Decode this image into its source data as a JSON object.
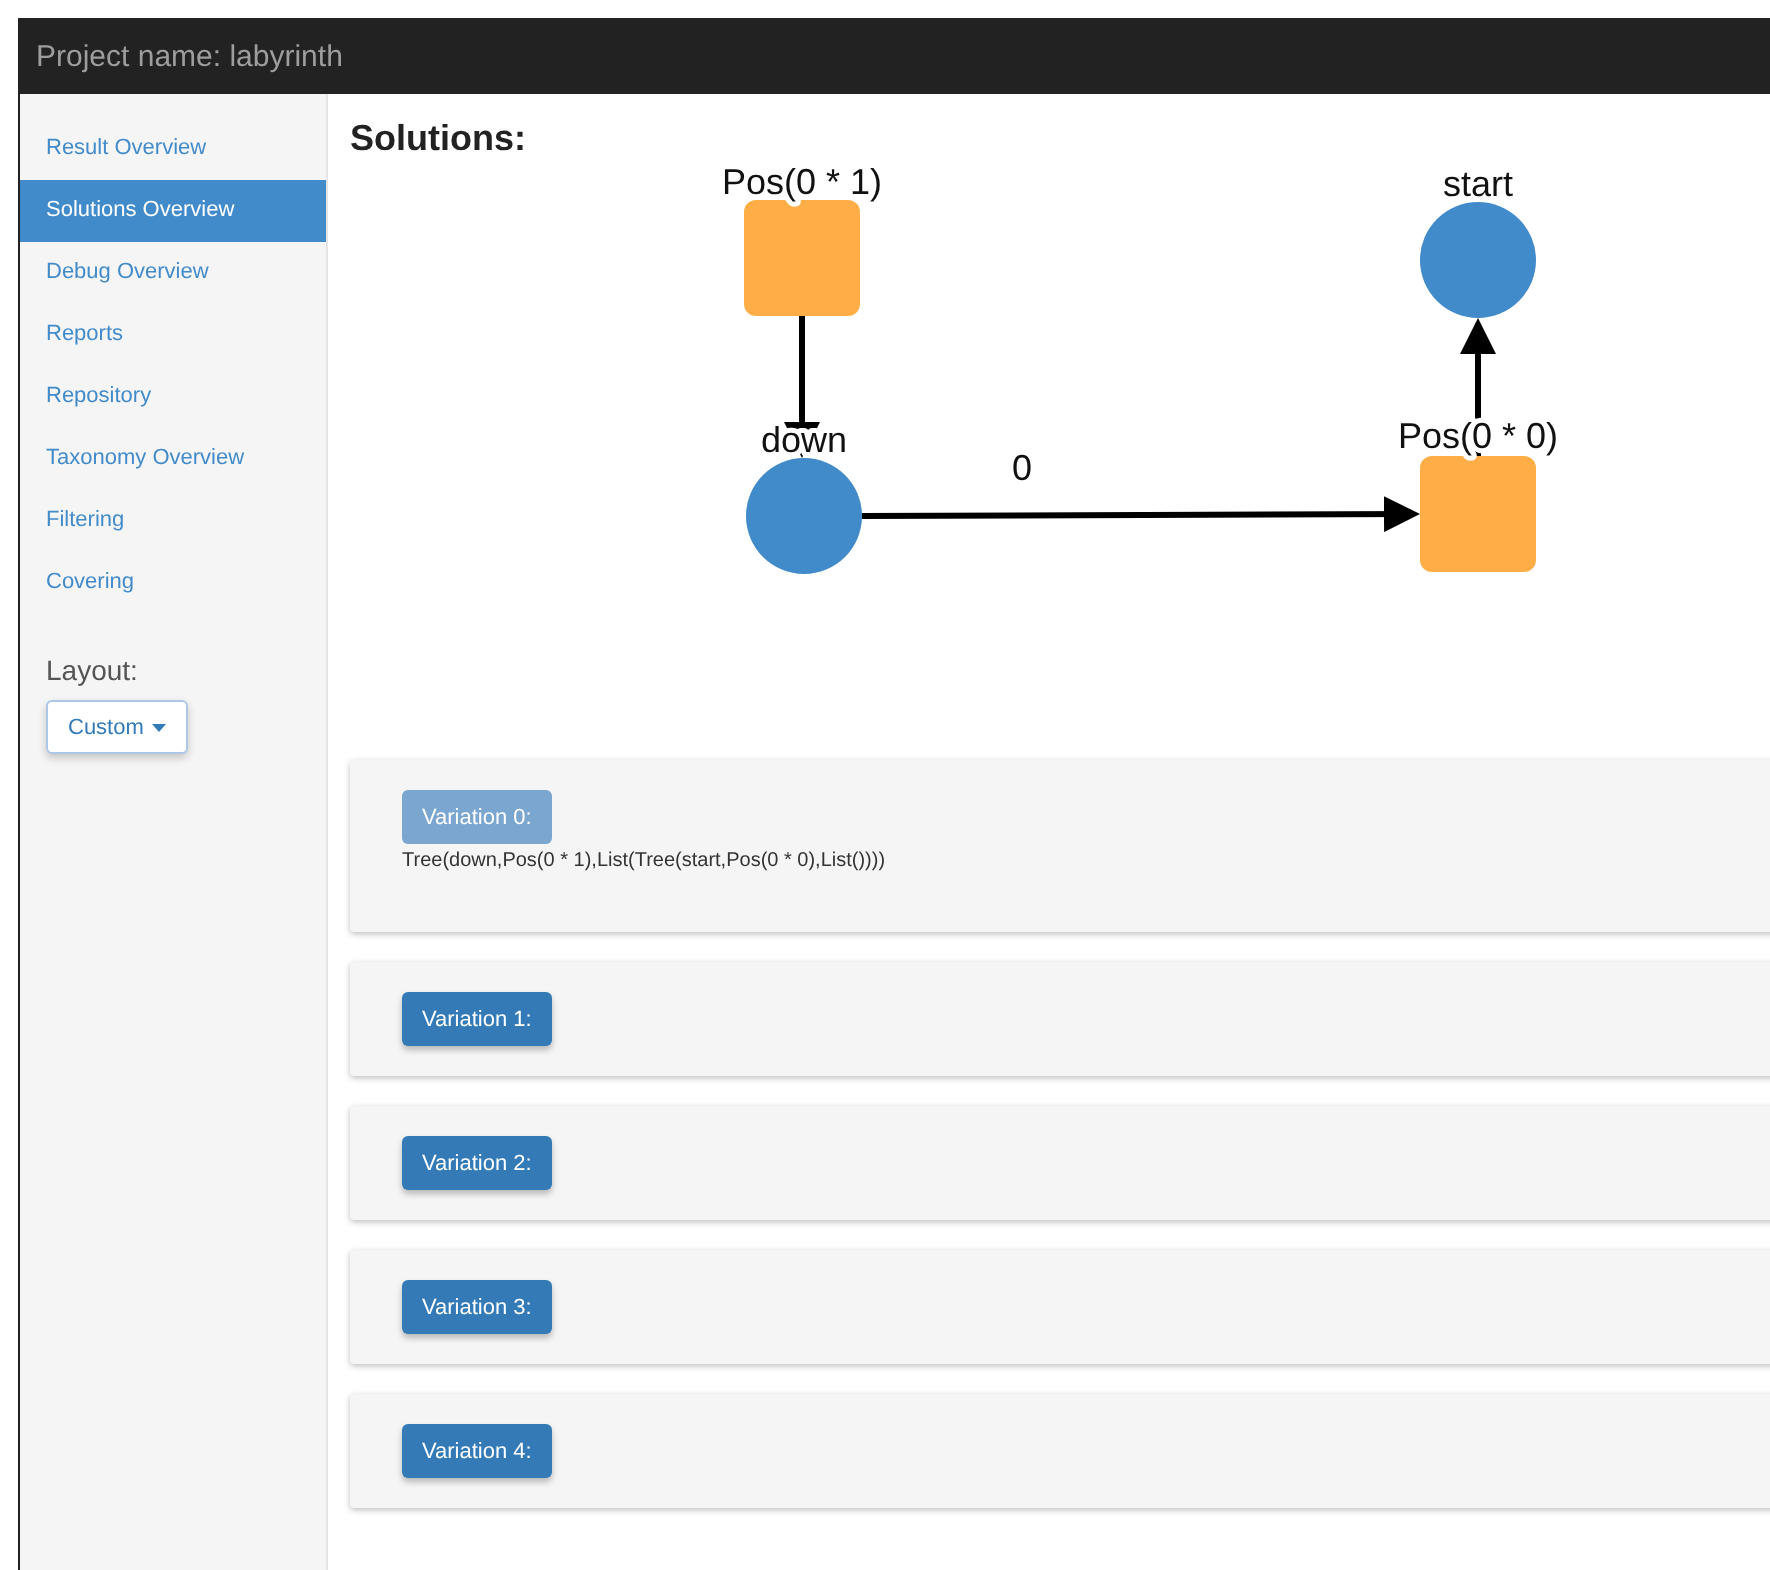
{
  "window": {
    "title": "Project name: labyrinth"
  },
  "sidebar": {
    "items": [
      {
        "label": "Result Overview",
        "selected": false
      },
      {
        "label": "Solutions Overview",
        "selected": true
      },
      {
        "label": "Debug Overview",
        "selected": false
      },
      {
        "label": "Reports",
        "selected": false
      },
      {
        "label": "Repository",
        "selected": false
      },
      {
        "label": "Taxonomy Overview",
        "selected": false
      },
      {
        "label": "Filtering",
        "selected": false
      },
      {
        "label": "Covering",
        "selected": false
      }
    ],
    "layout_label": "Layout:",
    "layout_button": "Custom"
  },
  "heading": "Solutions:",
  "graph": {
    "nodes": [
      {
        "kind": "square",
        "label": "Pos(0 * 1)"
      },
      {
        "kind": "circle",
        "label": "start"
      },
      {
        "kind": "circle",
        "label": "down"
      },
      {
        "kind": "square",
        "label": "Pos(0 * 0)"
      }
    ],
    "edges": [
      {
        "label": "0"
      }
    ]
  },
  "variations": [
    {
      "label": "Variation 0:",
      "expanded": true,
      "detail": "Tree(down,Pos(0 * 1),List(Tree(start,Pos(0 * 0),List())))"
    },
    {
      "label": "Variation 1:",
      "expanded": false
    },
    {
      "label": "Variation 2:",
      "expanded": false
    },
    {
      "label": "Variation 3:",
      "expanded": false
    },
    {
      "label": "Variation 4:",
      "expanded": false
    }
  ]
}
